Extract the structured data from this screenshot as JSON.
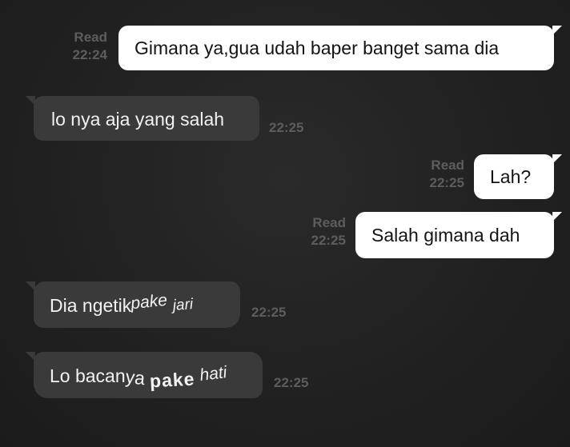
{
  "messages": [
    {
      "direction": "out",
      "status": "Read",
      "time": "22:24",
      "text": "Gimana ya,gua udah baper banget sama dia"
    },
    {
      "direction": "in",
      "time": "22:25",
      "text": "lo nya aja yang salah"
    },
    {
      "direction": "out",
      "status": "Read",
      "time": "22:25",
      "text": "Lah?"
    },
    {
      "direction": "out",
      "status": "Read",
      "time": "22:25",
      "text": "Salah gimana dah"
    },
    {
      "direction": "in",
      "time": "22:25",
      "text_parts": [
        "Dia ngetik",
        "pake",
        "jari"
      ]
    },
    {
      "direction": "in",
      "time": "22:25",
      "text_parts": [
        "Lo bacan",
        "ya",
        "pake",
        "hati"
      ]
    }
  ],
  "colors": {
    "background": "#212121",
    "outgoing_bubble": "#ffffff",
    "incoming_bubble": "#3a3a3a",
    "meta_text": "#5d5d5d"
  }
}
